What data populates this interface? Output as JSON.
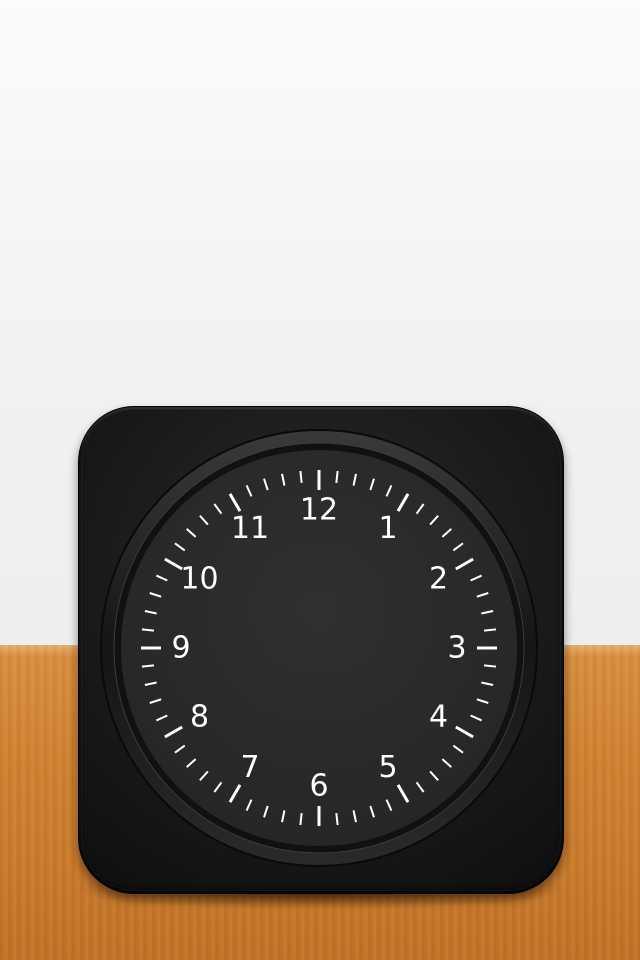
{
  "clock": {
    "hour_labels": [
      "12",
      "1",
      "2",
      "3",
      "4",
      "5",
      "6",
      "7",
      "8",
      "9",
      "10",
      "11"
    ]
  },
  "colors": {
    "wall": "#f2f2f2",
    "table": "#cf8232",
    "body": "#161616",
    "face": "#2b2b2b",
    "marks": "#ffffff"
  }
}
